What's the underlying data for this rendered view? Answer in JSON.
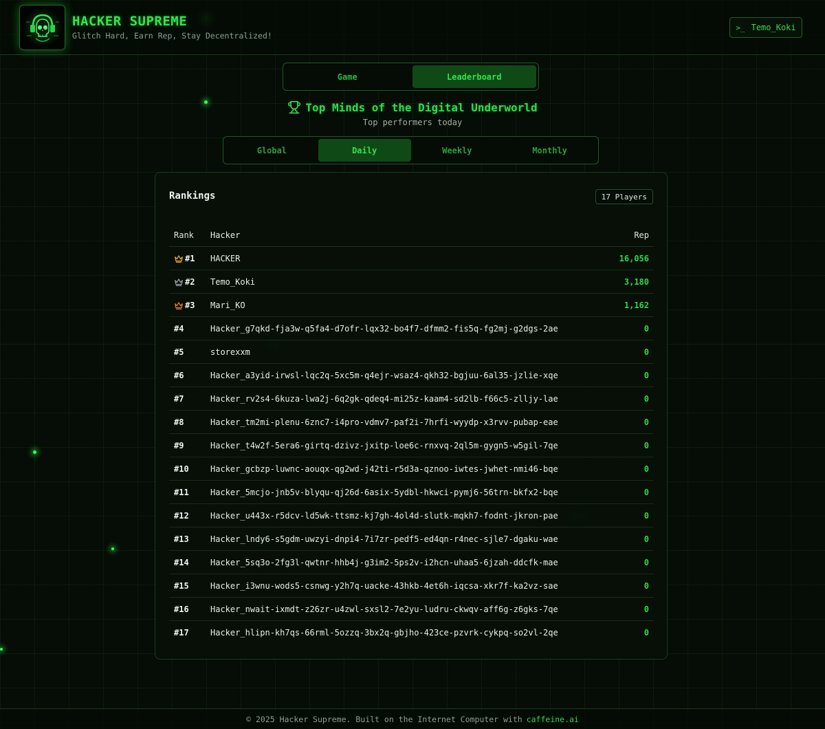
{
  "header": {
    "brand_title": "HACKER SUPREME",
    "brand_tagline": "Glitch Hard, Earn Rep, Stay Decentralized!",
    "logo_icon": "skull-headphones-icon",
    "user_button_icon": "terminal-icon",
    "user_button_icon_glyph": ">_",
    "username": "Temo_Koki"
  },
  "main_nav": {
    "tabs": [
      {
        "label": "Game",
        "active": false
      },
      {
        "label": "Leaderboard",
        "active": true
      }
    ]
  },
  "leaderboard": {
    "title_icon": "trophy-icon",
    "title": "Top Minds of the Digital Underworld",
    "subtitle": "Top performers today",
    "period_tabs": [
      {
        "label": "Global",
        "active": false
      },
      {
        "label": "Daily",
        "active": true
      },
      {
        "label": "Weekly",
        "active": false
      },
      {
        "label": "Monthly",
        "active": false
      }
    ],
    "card_title": "Rankings",
    "player_count_badge": "17 Players",
    "columns": {
      "rank": "Rank",
      "hacker": "Hacker",
      "rep": "Rep"
    },
    "rows": [
      {
        "rank": "#1",
        "crown": "gold",
        "name": "HACKER",
        "rep": "16,056"
      },
      {
        "rank": "#2",
        "crown": "silver",
        "name": "Temo_Koki",
        "rep": "3,180"
      },
      {
        "rank": "#3",
        "crown": "bronze",
        "name": "Mari_KO",
        "rep": "1,162"
      },
      {
        "rank": "#4",
        "crown": "",
        "name": "Hacker_g7qkd-fja3w-q5fa4-d7ofr-lqx32-bo4f7-dfmm2-fis5q-fg2mj-g2dgs-2ae",
        "rep": "0"
      },
      {
        "rank": "#5",
        "crown": "",
        "name": "storexxm",
        "rep": "0"
      },
      {
        "rank": "#6",
        "crown": "",
        "name": "Hacker_a3yid-irwsl-lqc2q-5xc5m-q4ejr-wsaz4-qkh32-bgjuu-6al35-jzlie-xqe",
        "rep": "0"
      },
      {
        "rank": "#7",
        "crown": "",
        "name": "Hacker_rv2s4-6kuza-lwa2j-6q2gk-qdeq4-mi25z-kaam4-sd2lb-f66c5-zlljy-lae",
        "rep": "0"
      },
      {
        "rank": "#8",
        "crown": "",
        "name": "Hacker_tm2mi-plenu-6znc7-i4pro-vdmv7-paf2i-7hrfi-wyydp-x3rvv-pubap-eae",
        "rep": "0"
      },
      {
        "rank": "#9",
        "crown": "",
        "name": "Hacker_t4w2f-5era6-girtq-dzivz-jxitp-loe6c-rnxvq-2ql5m-gygn5-w5gil-7qe",
        "rep": "0"
      },
      {
        "rank": "#10",
        "crown": "",
        "name": "Hacker_gcbzp-luwnc-aouqx-qg2wd-j42ti-r5d3a-qznoo-iwtes-jwhet-nmi46-bqe",
        "rep": "0"
      },
      {
        "rank": "#11",
        "crown": "",
        "name": "Hacker_5mcjo-jnb5v-blyqu-qj26d-6asix-5ydbl-hkwci-pymj6-56trn-bkfx2-bqe",
        "rep": "0"
      },
      {
        "rank": "#12",
        "crown": "",
        "name": "Hacker_u443x-r5dcv-ld5wk-ttsmz-kj7gh-4ol4d-slutk-mqkh7-fodnt-jkron-pae",
        "rep": "0"
      },
      {
        "rank": "#13",
        "crown": "",
        "name": "Hacker_lndy6-s5gdm-uwzyi-dnpi4-7i7zr-pedf5-ed4qn-r4nec-sjle7-dgaku-wae",
        "rep": "0"
      },
      {
        "rank": "#14",
        "crown": "",
        "name": "Hacker_5sq3o-2fg3l-qwtnr-hhb4j-g3im2-5ps2v-i2hcn-uhaa5-6jzah-ddcfk-mae",
        "rep": "0"
      },
      {
        "rank": "#15",
        "crown": "",
        "name": "Hacker_i3wnu-wods5-csnwg-y2h7q-uacke-43hkb-4et6h-iqcsa-xkr7f-ka2vz-sae",
        "rep": "0"
      },
      {
        "rank": "#16",
        "crown": "",
        "name": "Hacker_nwait-ixmdt-z26zr-u4zwl-sxsl2-7e2yu-ludru-ckwqv-aff6g-z6gks-7qe",
        "rep": "0"
      },
      {
        "rank": "#17",
        "crown": "",
        "name": "Hacker_hlipn-kh7qs-66rml-5ozzq-3bx2q-gbjho-423ce-pzvrk-cykpq-so2vl-2qe",
        "rep": "0"
      }
    ]
  },
  "footer": {
    "text": "© 2025 Hacker Supreme. Built on the Internet Computer with",
    "link_label": "caffeine.ai"
  },
  "colors": {
    "accent_green": "#2edb4b",
    "crown_gold": "#e8a52a",
    "crown_silver": "#9aa0a6",
    "crown_bronze": "#e07b2f"
  }
}
